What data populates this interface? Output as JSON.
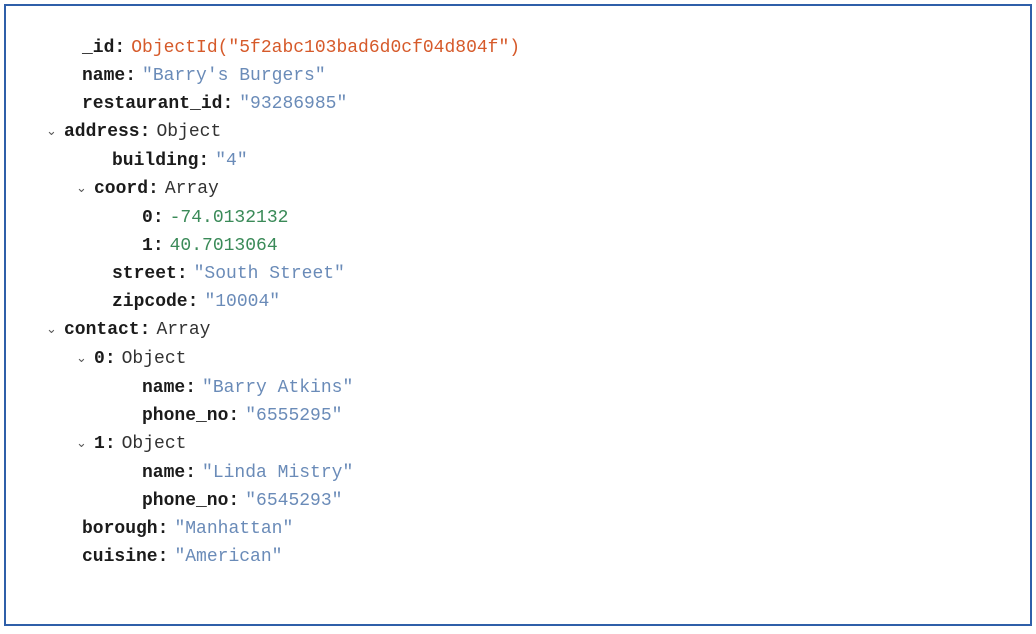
{
  "doc": {
    "id_key": "_id",
    "id_val": "ObjectId(\"5f2abc103bad6d0cf04d804f\")",
    "name_key": "name",
    "name_val": "\"Barry's Burgers\"",
    "restaurant_id_key": "restaurant_id",
    "restaurant_id_val": "\"93286985\"",
    "address_key": "address",
    "address_type": "Object",
    "address": {
      "building_key": "building",
      "building_val": "\"4\"",
      "coord_key": "coord",
      "coord_type": "Array",
      "coord": {
        "k0": "0",
        "v0": "-74.0132132",
        "k1": "1",
        "v1": "40.7013064"
      },
      "street_key": "street",
      "street_val": "\"South Street\"",
      "zipcode_key": "zipcode",
      "zipcode_val": "\"10004\""
    },
    "contact_key": "contact",
    "contact_type": "Array",
    "contact": {
      "k0": "0",
      "t0": "Object",
      "c0": {
        "name_key": "name",
        "name_val": "\"Barry Atkins\"",
        "phone_key": "phone_no",
        "phone_val": "\"6555295\""
      },
      "k1": "1",
      "t1": "Object",
      "c1": {
        "name_key": "name",
        "name_val": "\"Linda Mistry\"",
        "phone_key": "phone_no",
        "phone_val": "\"6545293\""
      }
    },
    "borough_key": "borough",
    "borough_val": "\"Manhattan\"",
    "cuisine_key": "cuisine",
    "cuisine_val": "\"American\""
  },
  "ui": {
    "chevron_down": "⌄"
  }
}
